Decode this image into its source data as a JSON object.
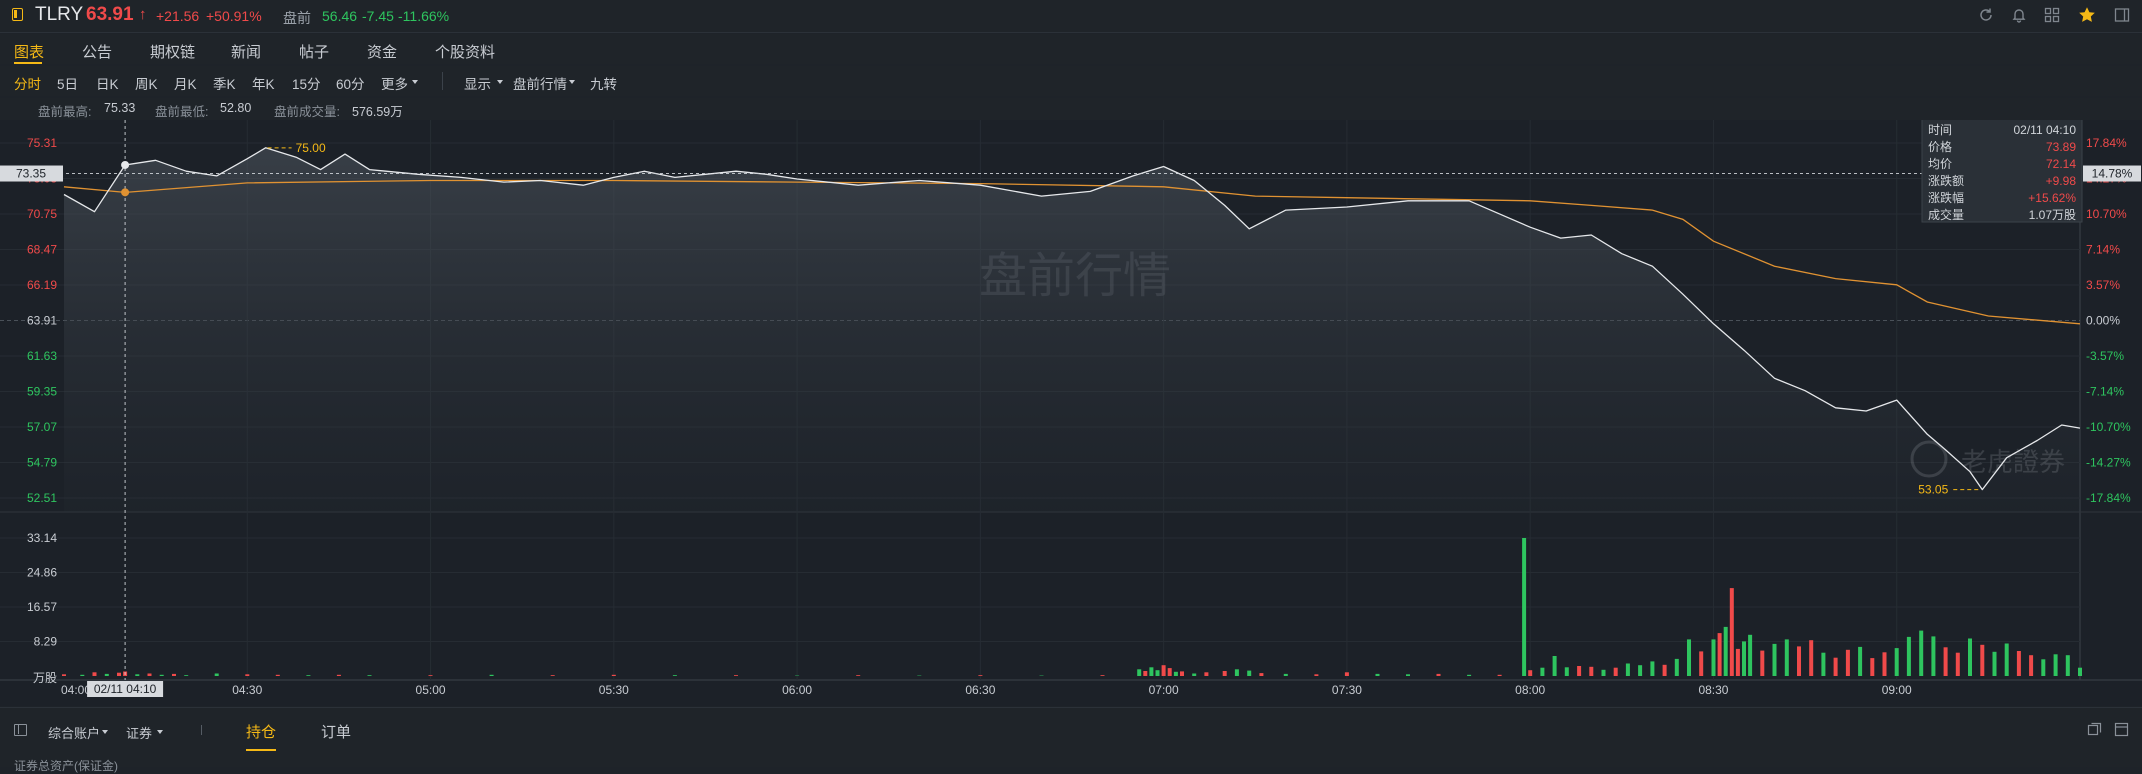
{
  "header": {
    "symbol": "TLRY",
    "price": "63.91",
    "arrow": "↑",
    "change": "+21.56",
    "change_pct": "+50.91%",
    "pre_label": "盘前",
    "pre_price": "56.46",
    "pre_change": "-7.45",
    "pre_change_pct": "-11.66%"
  },
  "tabs": [
    "图表",
    "公告",
    "期权链",
    "新闻",
    "帖子",
    "资金",
    "个股资料"
  ],
  "periods": [
    "分时",
    "5日",
    "日K",
    "周K",
    "月K",
    "季K",
    "年K",
    "15分",
    "60分",
    "更多"
  ],
  "controls": {
    "display": "显示",
    "mode": "盘前行情",
    "nine": "九转"
  },
  "stats": {
    "high_label": "盘前最高:",
    "high": "75.33",
    "low_label": "盘前最低:",
    "low": "52.80",
    "vol_label": "盘前成交量:",
    "vol": "576.59万"
  },
  "tooltip": {
    "time_label": "时间",
    "time": "02/11 04:10",
    "price_label": "价格",
    "price": "73.89",
    "avg_label": "均价",
    "avg": "72.14",
    "chg_label": "涨跌额",
    "chg": "+9.98",
    "pct_label": "涨跌幅",
    "pct": "+15.62%",
    "vol_label": "成交量",
    "vol": "1.07万股"
  },
  "crosshair": {
    "price": "73.35",
    "pct": "14.78%",
    "time": "02/11 04:10"
  },
  "watermark": "盘前行情",
  "brand": "老虎證券",
  "annotations": {
    "max": "75.00",
    "min": "53.05"
  },
  "bottom": {
    "account": "综合账户",
    "type": "证券",
    "tab_hold": "持仓",
    "tab_order": "订单",
    "sub": "证券总资产(保证金)"
  },
  "colors": {
    "up": "#f04a4a",
    "down": "#2ec55f",
    "accent": "#f5b916",
    "avg": "#e09232",
    "price": "#e6e8eb"
  },
  "chart_data": {
    "type": "line",
    "title": "",
    "x_ticks": [
      "04:00",
      "04:30",
      "05:00",
      "05:30",
      "06:00",
      "06:30",
      "07:00",
      "07:30",
      "08:00",
      "08:30",
      "09:00"
    ],
    "xlim": [
      "04:00",
      "09:30"
    ],
    "y_ticks": [
      "75.31",
      "73.03",
      "70.75",
      "68.47",
      "66.19",
      "63.91",
      "61.63",
      "59.35",
      "57.07",
      "54.79",
      "52.51"
    ],
    "pct_ticks": [
      "17.84%",
      "14.27%",
      "10.70%",
      "7.14%",
      "3.57%",
      "0.00%",
      "-3.57%",
      "-7.14%",
      "-10.70%",
      "-14.27%",
      "-17.84%"
    ],
    "ylim": [
      52.51,
      75.31
    ],
    "prev_close": 63.91,
    "vol_ticks": [
      "33.14",
      "24.86",
      "16.57",
      "8.29",
      "万股"
    ],
    "vol_max": 33.14,
    "price_series": [
      [
        "04:00",
        72.0
      ],
      [
        "04:05",
        70.9
      ],
      [
        "04:10",
        73.9
      ],
      [
        "04:15",
        74.2
      ],
      [
        "04:20",
        73.5
      ],
      [
        "04:25",
        73.2
      ],
      [
        "04:30",
        74.3
      ],
      [
        "04:33",
        75.0
      ],
      [
        "04:38",
        74.4
      ],
      [
        "04:42",
        73.6
      ],
      [
        "04:46",
        74.6
      ],
      [
        "04:50",
        73.6
      ],
      [
        "04:58",
        73.3
      ],
      [
        "05:05",
        73.1
      ],
      [
        "05:12",
        72.8
      ],
      [
        "05:18",
        72.9
      ],
      [
        "05:25",
        72.6
      ],
      [
        "05:30",
        73.1
      ],
      [
        "05:35",
        73.5
      ],
      [
        "05:40",
        73.1
      ],
      [
        "05:45",
        73.3
      ],
      [
        "05:50",
        73.5
      ],
      [
        "05:55",
        73.3
      ],
      [
        "06:00",
        73.0
      ],
      [
        "06:10",
        72.6
      ],
      [
        "06:20",
        72.9
      ],
      [
        "06:30",
        72.6
      ],
      [
        "06:40",
        71.9
      ],
      [
        "06:48",
        72.2
      ],
      [
        "06:55",
        73.2
      ],
      [
        "07:00",
        73.8
      ],
      [
        "07:05",
        72.9
      ],
      [
        "07:10",
        71.3
      ],
      [
        "07:14",
        69.8
      ],
      [
        "07:20",
        71.0
      ],
      [
        "07:30",
        71.2
      ],
      [
        "07:40",
        71.6
      ],
      [
        "07:50",
        71.6
      ],
      [
        "08:00",
        69.9
      ],
      [
        "08:05",
        69.2
      ],
      [
        "08:10",
        69.4
      ],
      [
        "08:15",
        68.2
      ],
      [
        "08:20",
        67.4
      ],
      [
        "08:25",
        65.6
      ],
      [
        "08:30",
        63.7
      ],
      [
        "08:35",
        62.0
      ],
      [
        "08:40",
        60.2
      ],
      [
        "08:45",
        59.4
      ],
      [
        "08:50",
        58.3
      ],
      [
        "08:55",
        58.1
      ],
      [
        "09:00",
        58.8
      ],
      [
        "09:05",
        56.6
      ],
      [
        "09:08",
        55.6
      ],
      [
        "09:12",
        54.2
      ],
      [
        "09:14",
        53.05
      ],
      [
        "09:18",
        55.1
      ],
      [
        "09:23",
        56.2
      ],
      [
        "09:27",
        57.2
      ],
      [
        "09:30",
        57.0
      ]
    ],
    "avg_series": [
      [
        "04:00",
        72.5
      ],
      [
        "04:10",
        72.14
      ],
      [
        "04:30",
        72.75
      ],
      [
        "05:00",
        72.9
      ],
      [
        "05:30",
        72.9
      ],
      [
        "06:00",
        72.8
      ],
      [
        "06:30",
        72.7
      ],
      [
        "07:00",
        72.5
      ],
      [
        "07:15",
        71.9
      ],
      [
        "07:30",
        71.8
      ],
      [
        "08:00",
        71.6
      ],
      [
        "08:10",
        71.3
      ],
      [
        "08:20",
        71.0
      ],
      [
        "08:25",
        70.4
      ],
      [
        "08:30",
        69.0
      ],
      [
        "08:40",
        67.4
      ],
      [
        "08:50",
        66.6
      ],
      [
        "09:00",
        66.2
      ],
      [
        "09:05",
        65.1
      ],
      [
        "09:15",
        64.2
      ],
      [
        "09:30",
        63.7
      ]
    ],
    "volume": [
      [
        "04:00",
        0.4,
        "up"
      ],
      [
        "04:03",
        0.3,
        "down"
      ],
      [
        "04:05",
        0.9,
        "up"
      ],
      [
        "04:07",
        0.5,
        "down"
      ],
      [
        "04:09",
        0.8,
        "up"
      ],
      [
        "04:10",
        1.07,
        "up"
      ],
      [
        "04:12",
        0.4,
        "down"
      ],
      [
        "04:14",
        0.6,
        "up"
      ],
      [
        "04:16",
        0.3,
        "down"
      ],
      [
        "04:18",
        0.5,
        "up"
      ],
      [
        "04:20",
        0.2,
        "down"
      ],
      [
        "04:25",
        0.6,
        "down"
      ],
      [
        "04:30",
        0.4,
        "up"
      ],
      [
        "04:35",
        0.3,
        "up"
      ],
      [
        "04:40",
        0.2,
        "down"
      ],
      [
        "04:45",
        0.3,
        "up"
      ],
      [
        "04:50",
        0.2,
        "down"
      ],
      [
        "05:00",
        0.2,
        "up"
      ],
      [
        "05:10",
        0.3,
        "down"
      ],
      [
        "05:20",
        0.2,
        "up"
      ],
      [
        "05:30",
        0.3,
        "up"
      ],
      [
        "05:40",
        0.2,
        "down"
      ],
      [
        "05:50",
        0.2,
        "up"
      ],
      [
        "06:00",
        0.1,
        "down"
      ],
      [
        "06:10",
        0.2,
        "up"
      ],
      [
        "06:20",
        0.1,
        "down"
      ],
      [
        "06:30",
        0.2,
        "up"
      ],
      [
        "06:40",
        0.1,
        "down"
      ],
      [
        "06:50",
        0.2,
        "up"
      ],
      [
        "06:56",
        1.6,
        "down"
      ],
      [
        "06:57",
        1.2,
        "up"
      ],
      [
        "06:58",
        2.1,
        "down"
      ],
      [
        "06:59",
        1.4,
        "down"
      ],
      [
        "07:00",
        2.6,
        "up"
      ],
      [
        "07:01",
        1.9,
        "up"
      ],
      [
        "07:02",
        1.0,
        "down"
      ],
      [
        "07:03",
        1.1,
        "up"
      ],
      [
        "07:05",
        0.6,
        "down"
      ],
      [
        "07:07",
        0.9,
        "up"
      ],
      [
        "07:10",
        1.2,
        "up"
      ],
      [
        "07:12",
        1.6,
        "down"
      ],
      [
        "07:14",
        1.3,
        "down"
      ],
      [
        "07:16",
        0.7,
        "up"
      ],
      [
        "07:20",
        0.5,
        "down"
      ],
      [
        "07:25",
        0.4,
        "up"
      ],
      [
        "07:30",
        0.9,
        "up"
      ],
      [
        "07:35",
        0.5,
        "down"
      ],
      [
        "07:40",
        0.4,
        "down"
      ],
      [
        "07:45",
        0.5,
        "up"
      ],
      [
        "07:50",
        0.3,
        "down"
      ],
      [
        "07:55",
        0.3,
        "up"
      ],
      [
        "07:59",
        33.14,
        "down"
      ],
      [
        "08:00",
        1.4,
        "up"
      ],
      [
        "08:02",
        2.0,
        "down"
      ],
      [
        "08:04",
        4.8,
        "down"
      ],
      [
        "08:06",
        2.1,
        "down"
      ],
      [
        "08:08",
        2.4,
        "up"
      ],
      [
        "08:10",
        2.2,
        "up"
      ],
      [
        "08:12",
        1.5,
        "down"
      ],
      [
        "08:14",
        2.0,
        "up"
      ],
      [
        "08:16",
        3.0,
        "down"
      ],
      [
        "08:18",
        2.6,
        "down"
      ],
      [
        "08:20",
        3.5,
        "down"
      ],
      [
        "08:22",
        2.7,
        "up"
      ],
      [
        "08:24",
        4.1,
        "down"
      ],
      [
        "08:26",
        8.8,
        "down"
      ],
      [
        "08:28",
        5.9,
        "up"
      ],
      [
        "08:30",
        8.8,
        "down"
      ],
      [
        "08:31",
        10.3,
        "up"
      ],
      [
        "08:32",
        11.8,
        "down"
      ],
      [
        "08:33",
        21.1,
        "up"
      ],
      [
        "08:34",
        6.5,
        "up"
      ],
      [
        "08:35",
        8.3,
        "down"
      ],
      [
        "08:36",
        9.9,
        "down"
      ],
      [
        "08:38",
        6.1,
        "up"
      ],
      [
        "08:40",
        7.7,
        "down"
      ],
      [
        "08:42",
        8.8,
        "down"
      ],
      [
        "08:44",
        7.1,
        "up"
      ],
      [
        "08:46",
        8.6,
        "up"
      ],
      [
        "08:48",
        5.6,
        "down"
      ],
      [
        "08:50",
        4.4,
        "up"
      ],
      [
        "08:52",
        6.3,
        "up"
      ],
      [
        "08:54",
        7.0,
        "down"
      ],
      [
        "08:56",
        4.3,
        "up"
      ],
      [
        "08:58",
        5.7,
        "up"
      ],
      [
        "09:00",
        6.7,
        "down"
      ],
      [
        "09:02",
        9.4,
        "down"
      ],
      [
        "09:04",
        10.9,
        "down"
      ],
      [
        "09:06",
        9.5,
        "down"
      ],
      [
        "09:08",
        6.9,
        "up"
      ],
      [
        "09:10",
        5.6,
        "up"
      ],
      [
        "09:12",
        9.0,
        "down"
      ],
      [
        "09:14",
        7.5,
        "up"
      ],
      [
        "09:16",
        5.8,
        "down"
      ],
      [
        "09:18",
        7.8,
        "down"
      ],
      [
        "09:20",
        6.0,
        "up"
      ],
      [
        "09:22",
        5.0,
        "up"
      ],
      [
        "09:24",
        4.0,
        "down"
      ],
      [
        "09:26",
        5.2,
        "down"
      ],
      [
        "09:28",
        5.0,
        "down"
      ],
      [
        "09:30",
        2.0,
        "down"
      ]
    ]
  }
}
